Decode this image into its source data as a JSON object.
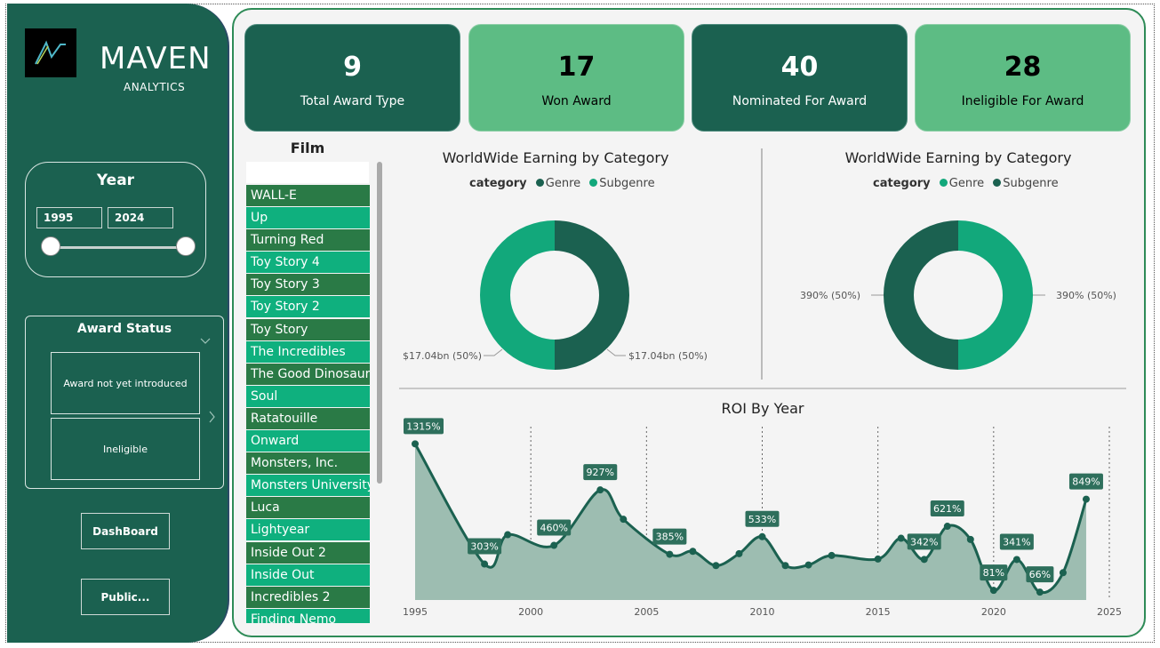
{
  "brand": {
    "name": "MAVEN",
    "sub": "ANALYTICS"
  },
  "year_filter": {
    "title": "Year",
    "from": "1995",
    "to": "2024"
  },
  "award_status": {
    "title": "Award Status",
    "options": [
      "Award not yet introduced",
      "Ineligible"
    ]
  },
  "nav": {
    "dashboard": "DashBoard",
    "public": "Public..."
  },
  "kpis": [
    {
      "value": "9",
      "label": "Total Award Type"
    },
    {
      "value": "17",
      "label": "Won Award"
    },
    {
      "value": "40",
      "label": "Nominated For Award"
    },
    {
      "value": "28",
      "label": "Ineligible For Award"
    }
  ],
  "film_slicer": {
    "title": "Film",
    "items": [
      "WALL-E",
      "Up",
      "Turning Red",
      "Toy Story 4",
      "Toy Story 3",
      "Toy Story 2",
      "Toy Story",
      "The Incredibles",
      "The Good Dinosaur",
      "Soul",
      "Ratatouille",
      "Onward",
      "Monsters, Inc.",
      "Monsters University",
      "Luca",
      "Lightyear",
      "Inside Out 2",
      "Inside Out",
      "Incredibles 2",
      "Finding Nemo"
    ]
  },
  "colors": {
    "dark": "#1b6150",
    "teal": "#12a87b",
    "light": "#5dbc84",
    "list_dark": "#2a7a46",
    "list_teal": "#0fb07e"
  },
  "chart_data": [
    {
      "type": "pie",
      "title": "WorldWide Earning by Category",
      "legend_title": "category",
      "legend": [
        "Genre",
        "Subgenre"
      ],
      "slices": [
        {
          "name": "Genre",
          "value": 17.04,
          "label": "$17.04bn (50%)",
          "color": "#1b6150"
        },
        {
          "name": "Subgenre",
          "value": 17.04,
          "label": "$17.04bn (50%)",
          "color": "#12a87b"
        }
      ]
    },
    {
      "type": "pie",
      "title": "WorldWide Earning by Category",
      "legend_title": "category",
      "legend": [
        "Genre",
        "Subgenre"
      ],
      "slices": [
        {
          "name": "Genre",
          "value": 390,
          "label": "390% (50%)",
          "color": "#12a87b"
        },
        {
          "name": "Subgenre",
          "value": 390,
          "label": "390% (50%)",
          "color": "#1b6150"
        }
      ]
    },
    {
      "type": "area",
      "title": "ROI By Year",
      "xlim": [
        1995,
        2025
      ],
      "ylim": [
        0,
        1400
      ],
      "x_ticks": [
        "1995",
        "2000",
        "2005",
        "2010",
        "2015",
        "2020",
        "2025"
      ],
      "x": [
        1995,
        1998,
        1999,
        2001,
        2003,
        2004,
        2006,
        2007,
        2008,
        2009,
        2010,
        2011,
        2012,
        2013,
        2015,
        2016,
        2017,
        2018,
        2019,
        2020,
        2021,
        2022,
        2023,
        2024
      ],
      "y": [
        1315,
        303,
        550,
        460,
        927,
        680,
        385,
        410,
        290,
        390,
        533,
        290,
        295,
        375,
        345,
        520,
        342,
        621,
        510,
        81,
        341,
        66,
        230,
        849
      ],
      "data_labels": [
        "1315%",
        "303%",
        "",
        "460%",
        "927%",
        "",
        "385%",
        "",
        "",
        "",
        "533%",
        "",
        "",
        "",
        "",
        "",
        "342%",
        "621%",
        "",
        "81%",
        "341%",
        "66%",
        "",
        "849%"
      ]
    }
  ]
}
